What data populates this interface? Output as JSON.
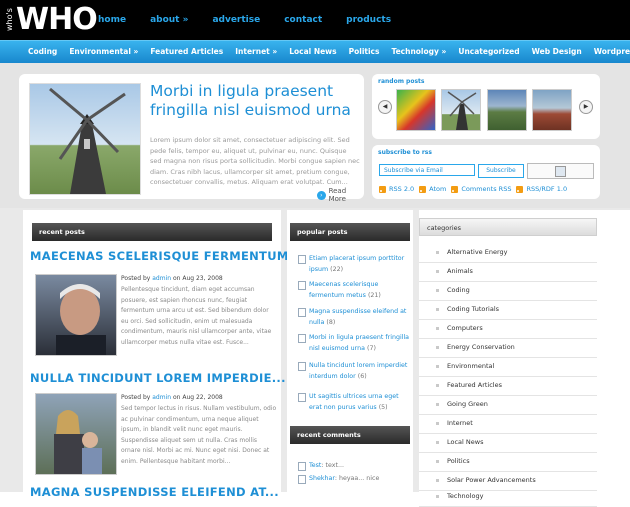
{
  "header": {
    "logo_small": "who's",
    "logo": "WHO",
    "nav": [
      "home",
      "about »",
      "advertise",
      "contact",
      "products"
    ]
  },
  "categories_bar": [
    "Coding",
    "Environmental »",
    "Featured Articles",
    "Internet »",
    "Local News",
    "Politics",
    "Technology »",
    "Uncategorized",
    "Web Design",
    "Wordpress"
  ],
  "featured": {
    "title": "Morbi in ligula praesent fringilla nisl euismod urna",
    "text": "Lorem ipsum dolor sit amet, consectetuer adipiscing elit. Sed pede felis, tempor eu, aliquet ut, pulvinar eu, nunc. Quisque sed magna non risus porta sollicitudin. Morbi congue sapien nec diam. Cras nibh lacus, ullamcorper sit amet, pretium congue, consectetuer convallis, metus. Aliquam erat volutpat. Cum...",
    "read_more": "Read More"
  },
  "random_posts": {
    "heading": "random posts"
  },
  "subscribe": {
    "heading": "subscribe to rss",
    "placeholder": "Subscribe via Email",
    "button": "Subscribe",
    "links": [
      "RSS 2.0",
      "Atom",
      "Comments RSS",
      "RSS/RDF 1.0"
    ]
  },
  "recent_posts": {
    "heading": "recent posts",
    "posts": [
      {
        "title": "MAECENAS SCELERISQUE FERMENTUM...",
        "meta_prefix": "Posted by",
        "author": "admin",
        "date": "on Aug 23, 2008",
        "excerpt": "Pellentesque tincidunt, diam eget accumsan posuere, est sapien rhoncus nunc, feugiat fermentum urna arcu ut est. Sed bibendum dolor eu orci. Sed sollicitudin, enim ut malesuada condimentum, mauris nisl ullamcorper ante, vitae ullamcorper metus nulla vitae est. Fusce..."
      },
      {
        "title": "NULLA TINCIDUNT LOREM IMPERDIE...",
        "meta_prefix": "Posted by",
        "author": "admin",
        "date": "on Aug 22, 2008",
        "excerpt": "Sed tempor lectus in risus. Nullam vestibulum, odio ac pulvinar condimentum, urna neque aliquet ipsum, in blandit velit nunc eget mauris. Suspendisse aliquet sem ut nulla. Cras mollis ornare nisl. Morbi ac mi. Nunc eget nisi. Donec at enim. Pellentesque habitant morbi..."
      },
      {
        "title": "MAGNA SUSPENDISSE ELEIFEND AT..."
      }
    ]
  },
  "popular_posts": {
    "heading": "popular posts",
    "items": [
      {
        "title": "Etiam placerat ipsum porttitor ipsum",
        "count": "(22)"
      },
      {
        "title": "Maecenas scelerisque fermentum metus",
        "count": "(21)"
      },
      {
        "title": "Magna suspendisse eleifend at nulla",
        "count": "(8)"
      },
      {
        "title": "Morbi in ligula praesent fringilla nisl euismod urna",
        "count": "(7)"
      },
      {
        "title": "Nulla tincidunt lorem imperdiet interdum dolor",
        "count": "(6)"
      },
      {
        "title": "Ut sagittis ultrices urna eget erat non purus varius",
        "count": "(5)"
      }
    ]
  },
  "recent_comments": {
    "heading": "recent comments",
    "items": [
      {
        "author": "Test",
        "text": ": text..."
      },
      {
        "author": "Shekhar",
        "text": ": heyaa... nice"
      }
    ]
  },
  "categories": {
    "heading": "categories",
    "items": [
      "Alternative Energy",
      "Animals",
      "Coding",
      "Coding Tutorials",
      "Computers",
      "Energy Conservation",
      "Environmental",
      "Featured Articles",
      "Going Green",
      "Internet",
      "Local News",
      "Politics",
      "Solar Power Advancements",
      "Technology"
    ]
  }
}
